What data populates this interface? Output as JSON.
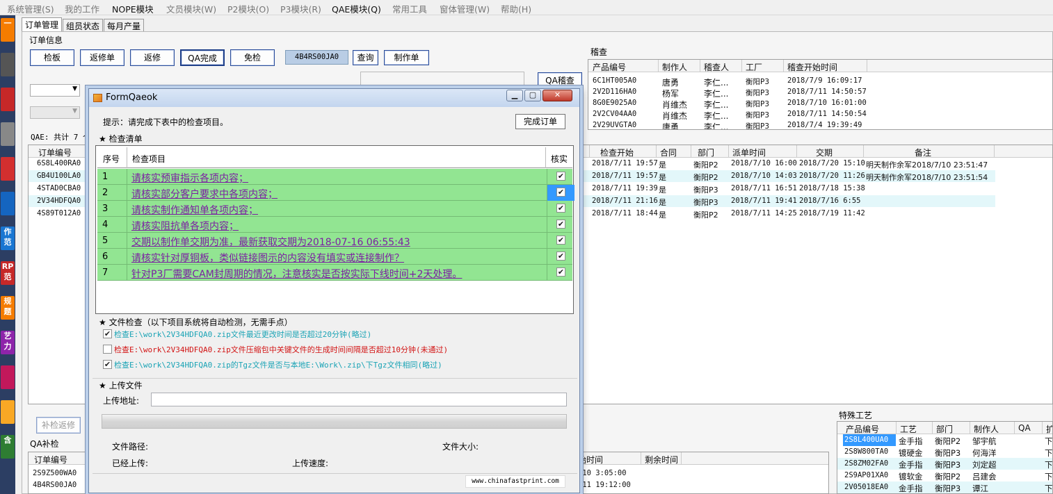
{
  "menu": [
    "系统管理(S)",
    "我的工作",
    "NOPE模块",
    "文员模块(W)",
    "P2模块(O)",
    "P3模块(R)",
    "QAE模块(Q)",
    "常用工具",
    "窗体管理(W)",
    "帮助(H)"
  ],
  "left_icons": [
    "一",
    "",
    "",
    "",
    "",
    "",
    "作范",
    "RP范",
    "规题",
    "艺力",
    "",
    "",
    "含"
  ],
  "tabs": [
    "订单管理",
    "组员状态",
    "每月产量"
  ],
  "order_info_label": "订单信息",
  "buttons": {
    "jianban": "检板",
    "fanxiudan": "返修单",
    "fanxiu": "返修",
    "qa_done": "QA完成",
    "mianjian": "免检",
    "search_value": "4B4RS00JA0",
    "query": "查询",
    "zhizuodan": "制作单",
    "qa_audit": "QA稽查",
    "buji": "补检返修"
  },
  "qae_count": "QAE: 共计 7 个",
  "audit": {
    "label": "稽查",
    "headers": [
      "产品编号",
      "制作人",
      "稽查人",
      "工厂",
      "稽查开始时间"
    ],
    "rows": [
      [
        "6C1HT005A0",
        "唐勇",
        "李仁...",
        "衡阳P3",
        "2018/7/9 16:09:17"
      ],
      [
        "2V2D116HA0",
        "杨军",
        "李仁...",
        "衡阳P3",
        "2018/7/11 14:50:57"
      ],
      [
        "8G0E9025A0",
        "肖维杰",
        "李仁...",
        "衡阳P3",
        "2018/7/10 16:01:00"
      ],
      [
        "2V2CV04AA0",
        "肖维杰",
        "李仁...",
        "衡阳P3",
        "2018/7/11 14:50:54"
      ],
      [
        "2V29UVGTA0",
        "唐勇",
        "李仁...",
        "衡阳P3",
        "2018/7/4 19:39:49"
      ]
    ]
  },
  "orders_left": {
    "header": "订单编号",
    "rows": [
      "6S8L400RA0",
      "GB4U100LA0",
      "4STAD0CBA0",
      "2V34HDFQA0",
      "4S89T012A0"
    ]
  },
  "orders_right": {
    "headers": [
      "检查开始",
      "合同",
      "部门",
      "派单时间",
      "交期",
      "备注"
    ],
    "rows": [
      [
        "2018/7/11 19:57",
        "是",
        "衡阳P2",
        "2018/7/10 16:00",
        "2018/7/20 15:10",
        "明天制作余军2018/7/10 23:51:47"
      ],
      [
        "2018/7/11 19:57",
        "是",
        "衡阳P2",
        "2018/7/10 14:03",
        "2018/7/20 11:26",
        "明天制作余军2018/7/10 23:51:54"
      ],
      [
        "2018/7/11 19:39",
        "是",
        "衡阳P3",
        "2018/7/11 16:51",
        "2018/7/18 15:38",
        ""
      ],
      [
        "2018/7/11 21:16",
        "是",
        "衡阳P3",
        "2018/7/11 19:41",
        "2018/7/16 6:55",
        ""
      ],
      [
        "2018/7/11 18:44",
        "是",
        "衡阳P2",
        "2018/7/11 14:25",
        "2018/7/19 11:42",
        ""
      ]
    ]
  },
  "qa_buji": {
    "label": "QA补检",
    "headers": [
      "订单编号",
      "始时间",
      "剩余时间"
    ],
    "rows": [
      [
        "2S9Z500WA0",
        "/10 3:05:00"
      ],
      [
        "4B4RS00JA0",
        "/11 19:12:00"
      ]
    ]
  },
  "special": {
    "label": "特殊工艺",
    "headers": [
      "产品编号",
      "工艺",
      "部门",
      "制作人",
      "QA",
      "扩"
    ],
    "rows": [
      [
        "2S8L400UA0",
        "金手指",
        "衡阳P2",
        "邹宇航",
        "",
        "下"
      ],
      [
        "2S8W800TA0",
        "镀硬金",
        "衡阳P3",
        "何海洋",
        "",
        "下"
      ],
      [
        "2S8ZM02FA0",
        "金手指",
        "衡阳P3",
        "刘定超",
        "",
        "下"
      ],
      [
        "2S9AP01XA0",
        "镀软金",
        "衡阳P2",
        "吕建会",
        "",
        "下"
      ],
      [
        "2V05018EA0",
        "金手指",
        "衡阳P3",
        "谭江",
        "",
        "下"
      ]
    ]
  },
  "dialog": {
    "title": "FormQaeok",
    "hint": "提示：请完成下表中的检查项目。",
    "finish_btn": "完成订单",
    "checklist_title": "★ 检查清单",
    "col_no": "序号",
    "col_item": "检查项目",
    "col_check": "核实",
    "items": [
      {
        "no": "1",
        "text": "请核实预审指示各项内容；",
        "checked": true
      },
      {
        "no": "2",
        "text": "请核实部分客户要求中各项内容；",
        "checked": true
      },
      {
        "no": "3",
        "text": "请核实制作通知单各项内容；",
        "checked": true
      },
      {
        "no": "4",
        "text": "请核实阻抗单各项内容；",
        "checked": true
      },
      {
        "no": "5",
        "text": "交期以制作单交期为准，最新获取交期为2018-07-16 06:55:43",
        "checked": true
      },
      {
        "no": "6",
        "text": "请核实针对厚铜板，类似链接图示的内容没有填实或连接制作？",
        "checked": true
      },
      {
        "no": "7",
        "text": "针对P3厂需要CAM封周期的情况，注意核实是否按实际下线时间+2天处理。",
        "checked": true
      }
    ],
    "file_check_title": "★ 文件检查（以下项目系统将自动检测，无需手点）",
    "file_checks": [
      {
        "text": "检查E:\\work\\2V34HDFQA0.zip文件最近更改时间是否超过20分钟(略过)",
        "checked": true,
        "color": "#1aa3b5"
      },
      {
        "text": "检查E:\\work\\2V34HDFQA0.zip文件压缩包中关键文件的生成时间间隔是否超过10分钟(未通过)",
        "checked": false,
        "color": "#d21414"
      },
      {
        "text": "检查E:\\work\\2V34HDFQA0.zip的Tgz文件是否与本地E:\\Work\\.zip\\下Tgz文件相同(略过)",
        "checked": true,
        "color": "#1aa3b5"
      }
    ],
    "upload_title": "★ 上传文件",
    "upload_addr_label": "上传地址:",
    "upload_addr_value": "",
    "file_path_label": "文件路径:",
    "file_size_label": "文件大小:",
    "uploaded_label": "已经上传:",
    "speed_label": "上传速度:",
    "footer_url": "www.chinafastprint.com",
    "progress": 0
  }
}
